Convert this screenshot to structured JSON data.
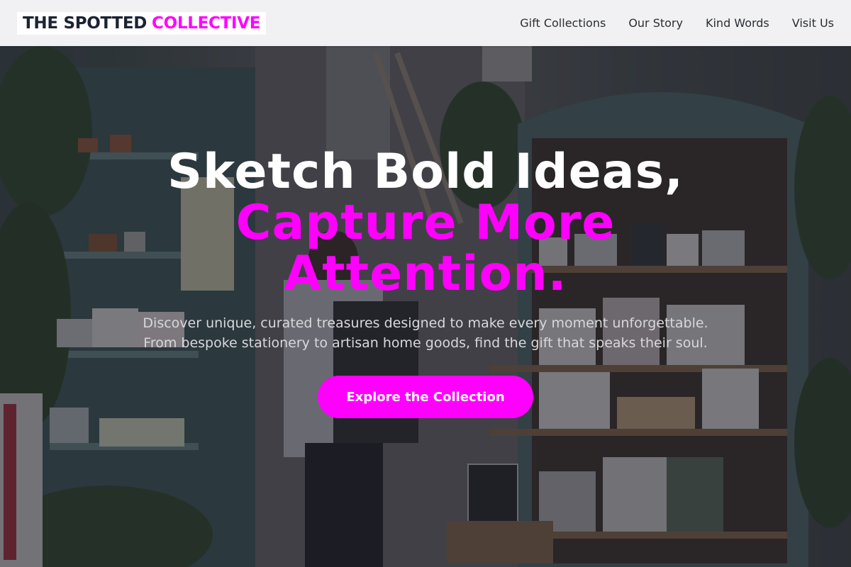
{
  "brand": {
    "part1": "THE SPOTTED",
    "part2": "COLLECTIVE"
  },
  "nav": {
    "items": [
      {
        "label": "Gift Collections"
      },
      {
        "label": "Our Story"
      },
      {
        "label": "Kind Words"
      },
      {
        "label": "Visit Us"
      }
    ]
  },
  "hero": {
    "headline_line1": "Sketch Bold Ideas,",
    "headline_line2": "Capture More",
    "headline_line3": "Attention.",
    "subtext_line1": "Discover unique, curated treasures designed to make every moment unforgettable.",
    "subtext_line2": "From bespoke stationery to artisan home goods, find the gift that speaks their soul.",
    "cta_label": "Explore the Collection"
  },
  "colors": {
    "accent": "#ff00ff",
    "brand_dark": "#1c2333",
    "nav_bg": "#f1f1f3"
  }
}
